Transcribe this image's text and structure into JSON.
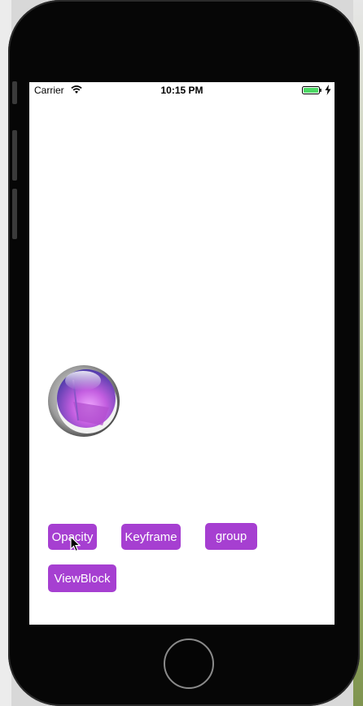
{
  "status_bar": {
    "carrier": "Carrier",
    "time": "10:15 PM",
    "battery_color": "#4cd964"
  },
  "buttons": {
    "opacity": "Opacity",
    "keyframe": "Keyframe",
    "group": "group",
    "viewblock": "ViewBlock"
  },
  "colors": {
    "button": "#a63fd1",
    "screen": "#ffffff",
    "phone": "#060606"
  },
  "icons": {
    "wifi": "wifi-icon",
    "battery": "battery-icon",
    "charge": "charge-icon",
    "orb": "orb-logo-icon",
    "cursor": "cursor-icon"
  }
}
